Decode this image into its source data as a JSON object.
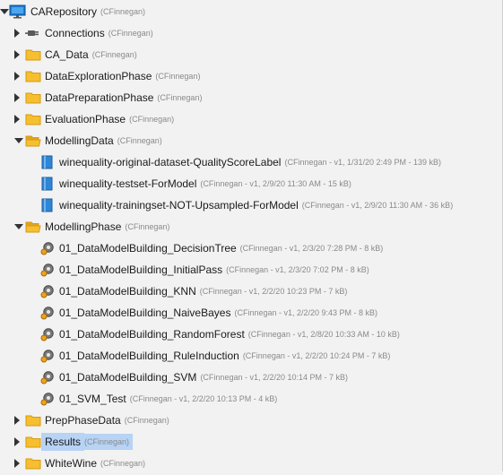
{
  "root": {
    "label": "CARepository",
    "owner": "(CFinnegan)"
  },
  "items": [
    {
      "label": "Connections",
      "owner": "(CFinnegan)"
    },
    {
      "label": "CA_Data",
      "owner": "(CFinnegan)"
    },
    {
      "label": "DataExplorationPhase",
      "owner": "(CFinnegan)"
    },
    {
      "label": "DataPreparationPhase",
      "owner": "(CFinnegan)"
    },
    {
      "label": "EvaluationPhase",
      "owner": "(CFinnegan)"
    },
    {
      "label": "ModellingData",
      "owner": "(CFinnegan)"
    },
    {
      "label": "winequality-original-dataset-QualityScoreLabel",
      "owner": "(CFinnegan - v1, 1/31/20 2:49 PM - 139 kB)"
    },
    {
      "label": "winequality-testset-ForModel",
      "owner": "(CFinnegan - v1, 2/9/20 11:30 AM - 15 kB)"
    },
    {
      "label": "winequality-trainingset-NOT-Upsampled-ForModel",
      "owner": "(CFinnegan - v1, 2/9/20 11:30 AM - 36 kB)"
    },
    {
      "label": "ModellingPhase",
      "owner": "(CFinnegan)"
    },
    {
      "label": "01_DataModelBuilding_DecisionTree",
      "owner": "(CFinnegan - v1, 2/3/20 7:28 PM - 8 kB)"
    },
    {
      "label": "01_DataModelBuilding_InitialPass",
      "owner": "(CFinnegan - v1, 2/3/20 7:02 PM - 8 kB)"
    },
    {
      "label": "01_DataModelBuilding_KNN",
      "owner": "(CFinnegan - v1, 2/2/20 10:23 PM - 7 kB)"
    },
    {
      "label": "01_DataModelBuilding_NaiveBayes",
      "owner": "(CFinnegan - v1, 2/2/20 9:43 PM - 8 kB)"
    },
    {
      "label": "01_DataModelBuilding_RandomForest",
      "owner": "(CFinnegan - v1, 2/8/20 10:33 AM - 10 kB)"
    },
    {
      "label": "01_DataModelBuilding_RuleInduction",
      "owner": "(CFinnegan - v1, 2/2/20 10:24 PM - 7 kB)"
    },
    {
      "label": "01_DataModelBuilding_SVM",
      "owner": "(CFinnegan - v1, 2/2/20 10:14 PM - 7 kB)"
    },
    {
      "label": "01_SVM_Test",
      "owner": "(CFinnegan - v1, 2/2/20 10:13 PM - 4 kB)"
    },
    {
      "label": "PrepPhaseData",
      "owner": "(CFinnegan)"
    },
    {
      "label": "Results",
      "owner": "(CFinnegan)"
    },
    {
      "label": "WhiteWine",
      "owner": "(CFinnegan)"
    }
  ],
  "colors": {
    "selection": "#b7d3f5",
    "folder": "#f5bf2f",
    "data_icon": "#2f86d6",
    "process_icon": "#7a7a7a",
    "monitor_icon": "#1f7ad1"
  }
}
